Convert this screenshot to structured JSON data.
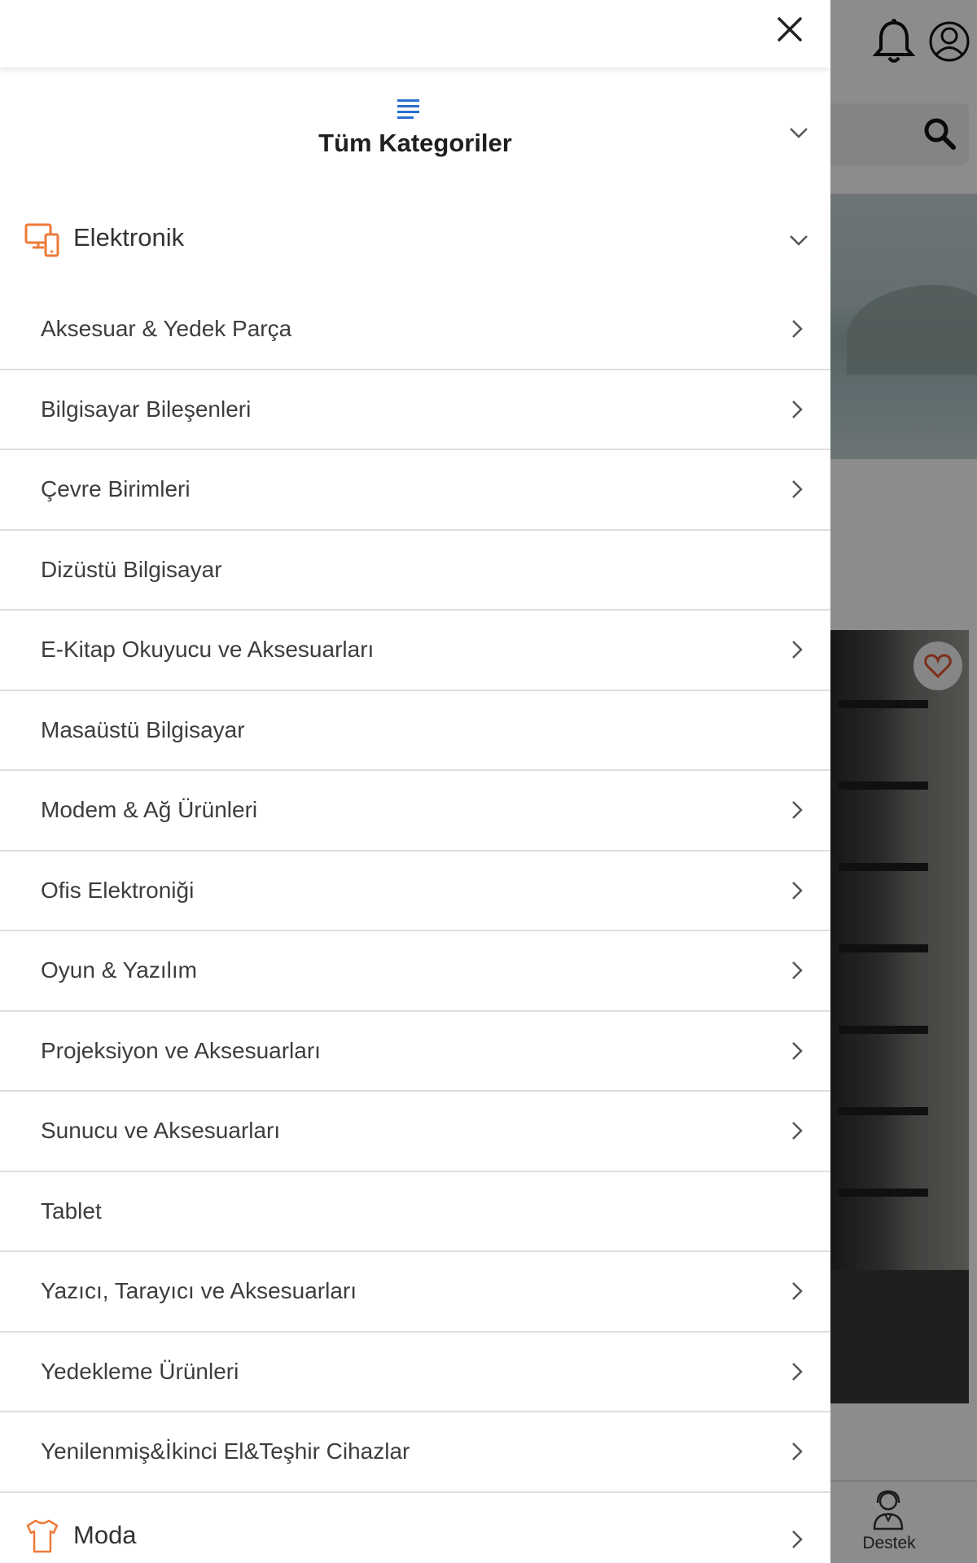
{
  "drawer": {
    "all_categories_label": "Tüm Kategoriler",
    "close_icon": "close-icon",
    "menu_icon": "list-icon",
    "accent_color": "#2a6fd1",
    "category_icon_color": "#ee7a3a"
  },
  "category_electronics": {
    "label": "Elektronik",
    "icon": "devices-icon",
    "expanded": true,
    "items": [
      {
        "label": "Aksesuar & Yedek Parça",
        "has_children": true
      },
      {
        "label": "Bilgisayar Bileşenleri",
        "has_children": true
      },
      {
        "label": "Çevre Birimleri",
        "has_children": true
      },
      {
        "label": "Dizüstü Bilgisayar",
        "has_children": false
      },
      {
        "label": "E-Kitap Okuyucu ve Aksesuarları",
        "has_children": true
      },
      {
        "label": "Masaüstü Bilgisayar",
        "has_children": false
      },
      {
        "label": "Modem & Ağ Ürünleri",
        "has_children": true
      },
      {
        "label": "Ofis Elektroniği",
        "has_children": true
      },
      {
        "label": "Oyun & Yazılım",
        "has_children": true
      },
      {
        "label": "Projeksiyon ve Aksesuarları",
        "has_children": true
      },
      {
        "label": "Sunucu ve Aksesuarları",
        "has_children": true
      },
      {
        "label": "Tablet",
        "has_children": false
      },
      {
        "label": "Yazıcı, Tarayıcı ve Aksesuarları",
        "has_children": true
      },
      {
        "label": "Yedekleme Ürünleri",
        "has_children": true
      },
      {
        "label": "Yenilenmiş&İkinci El&Teşhir Cihazlar",
        "has_children": true
      }
    ]
  },
  "category_fashion": {
    "label": "Moda",
    "icon": "tshirt-icon"
  },
  "background": {
    "bottom_nav_label": "Destek"
  }
}
